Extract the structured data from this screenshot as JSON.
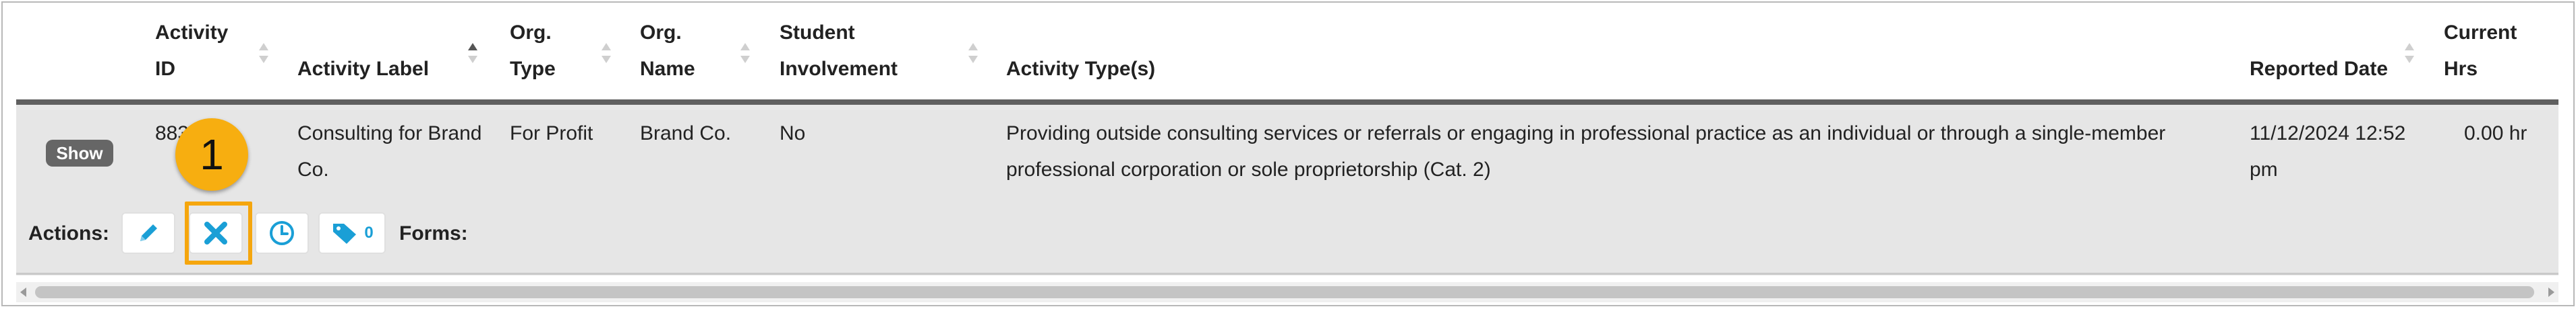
{
  "table": {
    "columns": [
      {
        "key": "activity_id",
        "line1": "Activity",
        "line2": "ID"
      },
      {
        "key": "activity_label",
        "line1": "",
        "line2": "Activity Label"
      },
      {
        "key": "org_type",
        "line1": "Org.",
        "line2": "Type"
      },
      {
        "key": "org_name",
        "line1": "Org.",
        "line2": "Name"
      },
      {
        "key": "student_involvement",
        "line1": "Student",
        "line2": "Involvement"
      },
      {
        "key": "activity_types",
        "line1": "",
        "line2": "Activity Type(s)"
      },
      {
        "key": "reported_date",
        "line1": "",
        "line2": "Reported Date"
      },
      {
        "key": "current_hrs",
        "line1": "Current",
        "line2": "Hrs"
      }
    ],
    "sorted_column": "activity_label",
    "rows": [
      {
        "show_label": "Show",
        "activity_id": "883",
        "activity_label_line1": "Consulting for Brand",
        "activity_label_line2": "Co.",
        "org_type": "For Profit",
        "org_name": "Brand Co.",
        "student_involvement": "No",
        "activity_types_line1": "Providing outside consulting services or referrals or engaging in professional practice as an individual or through a single-member",
        "activity_types_line2": "professional corporation or sole proprietorship (Cat. 2)",
        "reported_date_line1": "11/12/2024 12:52",
        "reported_date_line2": "pm",
        "current_hrs": "0.00 hr",
        "actions_label": "Actions:",
        "forms_label": "Forms:",
        "tag_count": "0"
      }
    ]
  },
  "annotation": {
    "callout_number": "1",
    "highlight_color": "#f5a60e"
  },
  "icons": {
    "edit": "pencil-icon",
    "delete": "x-icon",
    "history": "clock-icon",
    "tags": "tag-icon"
  },
  "colors": {
    "icon_blue": "#1a9fd6",
    "header_rule": "#5f5f5f",
    "row_bg": "#e6e6e6",
    "show_button": "#666666"
  }
}
